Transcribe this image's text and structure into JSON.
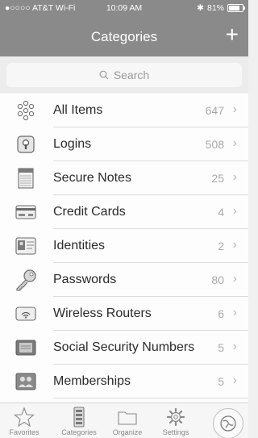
{
  "status_bar": {
    "carrier": "●○○○○ AT&T Wi-Fi",
    "time": "10:09 AM",
    "battery": "81%",
    "bluetooth": "✱"
  },
  "nav": {
    "title": "Categories",
    "add_label": "+"
  },
  "search": {
    "placeholder": "Search"
  },
  "categories": [
    {
      "label": "All Items",
      "count": "647",
      "icon": "all-items-icon"
    },
    {
      "label": "Logins",
      "count": "508",
      "icon": "login-icon"
    },
    {
      "label": "Secure Notes",
      "count": "25",
      "icon": "secure-note-icon"
    },
    {
      "label": "Credit Cards",
      "count": "4",
      "icon": "credit-card-icon"
    },
    {
      "label": "Identities",
      "count": "2",
      "icon": "identity-icon"
    },
    {
      "label": "Passwords",
      "count": "80",
      "icon": "key-icon"
    },
    {
      "label": "Wireless Routers",
      "count": "6",
      "icon": "router-icon"
    },
    {
      "label": "Social Security Numbers",
      "count": "5",
      "icon": "ssn-card-icon"
    },
    {
      "label": "Memberships",
      "count": "5",
      "icon": "membership-icon"
    }
  ],
  "chevron": "›",
  "tabs": [
    {
      "label": "Favorites",
      "icon": "star-icon"
    },
    {
      "label": "Categories",
      "icon": "categories-icon"
    },
    {
      "label": "Organize",
      "icon": "folder-icon"
    },
    {
      "label": "Settings",
      "icon": "gear-icon"
    }
  ],
  "colors": {
    "nav_bg": "#8a8a8a",
    "search_bg": "#ececec",
    "text": "#2b2b2b",
    "count": "#a8a8a8"
  }
}
